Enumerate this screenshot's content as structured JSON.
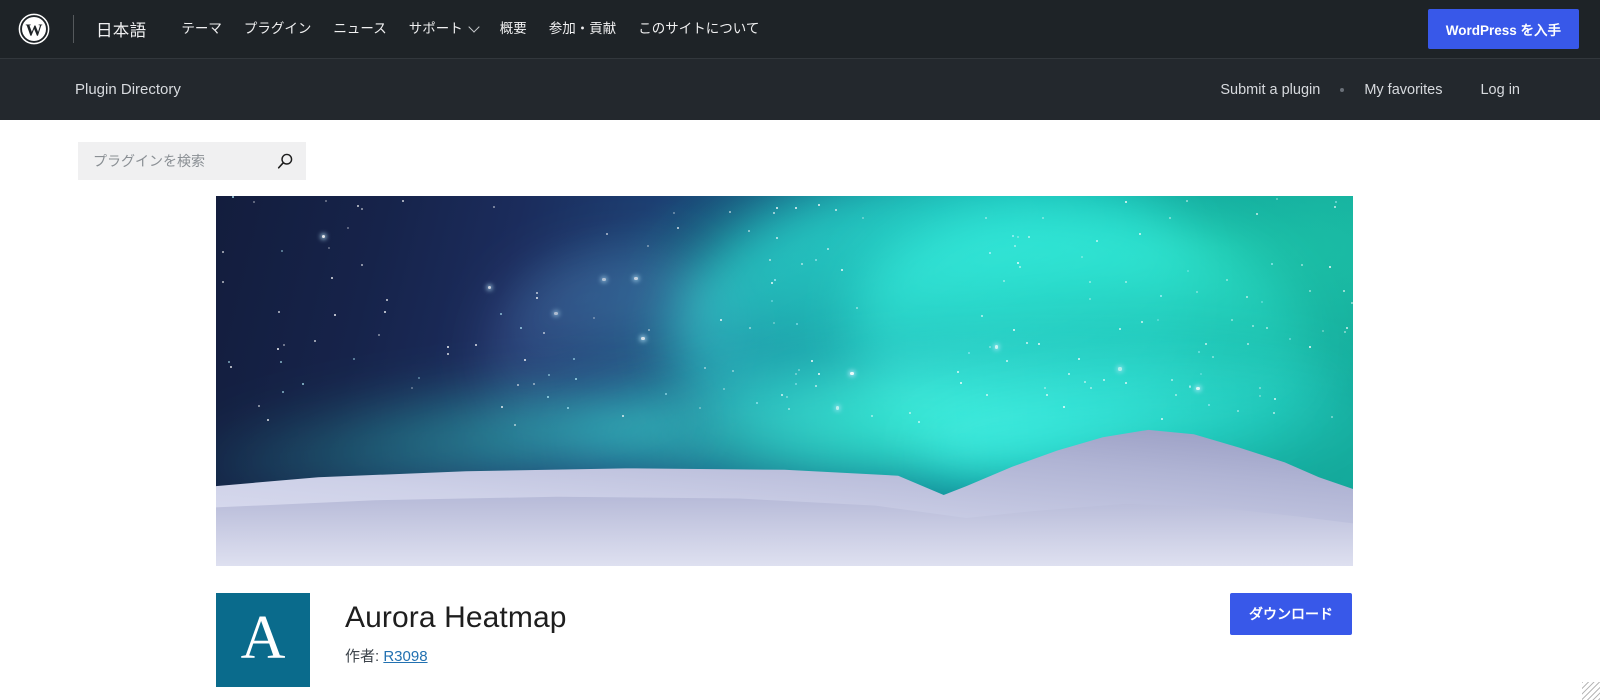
{
  "global_bar": {
    "logo_icon": "wordpress-logo-icon",
    "locale": "日本語",
    "nav": [
      {
        "label": "テーマ",
        "has_dropdown": false
      },
      {
        "label": "プラグイン",
        "has_dropdown": false
      },
      {
        "label": "ニュース",
        "has_dropdown": false
      },
      {
        "label": "サポート",
        "has_dropdown": true,
        "dropdown_icon": "chevron-down-icon"
      },
      {
        "label": "概要",
        "has_dropdown": false
      },
      {
        "label": "参加・貢献",
        "has_dropdown": false
      },
      {
        "label": "このサイトについて",
        "has_dropdown": false
      }
    ],
    "cta_label": "WordPress を入手",
    "cta_color": "#3858e9",
    "background": "#1e2327"
  },
  "directory_bar": {
    "title": "Plugin Directory",
    "links": [
      {
        "label": "Submit a plugin"
      },
      {
        "label": "My favorites"
      },
      {
        "label": "Log in"
      }
    ],
    "separator_icon": "bullet-separator-icon",
    "background": "#23282d"
  },
  "search": {
    "placeholder": "プラグインを検索",
    "value": "",
    "icon": "search-icon",
    "background": "#f0f0f1"
  },
  "banner": {
    "alt": "Aurora borealis over a snowy landscape",
    "sky_top_color": "#131d3d",
    "aurora_color": "#2ceaad",
    "snow_color": "#cdd0e8"
  },
  "plugin": {
    "icon_letter": "A",
    "icon_color": "#0a6b8c",
    "title": "Aurora Heatmap",
    "author_label": "作者:",
    "author_name": "R3098",
    "author_link_color": "#2271b1",
    "download_label": "ダウンロード",
    "download_color": "#3858e9"
  },
  "window": {
    "resize_handle_icon": "resize-grip-icon"
  }
}
